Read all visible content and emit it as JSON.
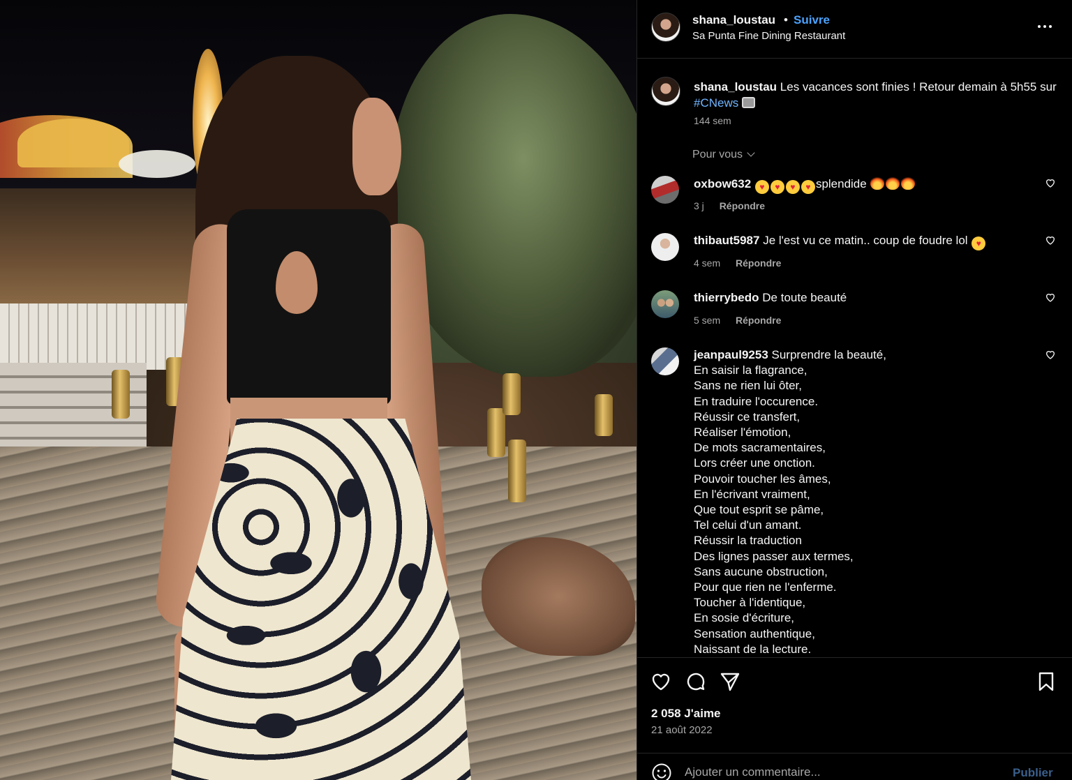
{
  "post": {
    "username": "shana_loustau",
    "separator": "•",
    "follow_label": "Suivre",
    "location": "Sa Punta Fine Dining Restaurant",
    "more_icon": "more-horizontal-icon"
  },
  "caption": {
    "username": "shana_loustau",
    "text_before": "Les vacances sont finies ! Retour demain à 5h55 sur",
    "hashtag": "#CNews",
    "emoji": "television-emoji",
    "time": "144 sem"
  },
  "for_you_label": "Pour vous",
  "comments": [
    {
      "username": "oxbow632",
      "text": "splendide",
      "time": "3 j",
      "reply_label": "Répondre"
    },
    {
      "username": "thibaut5987",
      "text": "Je l'est vu ce matin.. coup de foudre lol",
      "time": "4 sem",
      "reply_label": "Répondre"
    },
    {
      "username": "thierrybedo",
      "text": "De toute beauté",
      "time": "5 sem",
      "reply_label": "Répondre"
    },
    {
      "username": "jeanpaul9253",
      "lines": [
        "Surprendre la beauté,",
        "En saisir la flagrance,",
        "Sans ne rien lui ôter,",
        "En traduire l'occurence.",
        "Réussir ce transfert,",
        "Réaliser l'émotion,",
        "De mots sacramentaires,",
        "Lors créer une onction.",
        "Pouvoir toucher les âmes,",
        "En l'écrivant vraiment,",
        "Que tout esprit se pâme,",
        "Tel celui d'un amant.",
        "Réussir la traduction",
        "Des lignes passer aux termes,",
        "Sans aucune obstruction,",
        "Pour que rien ne l'enferme.",
        "Toucher à  l'identique,",
        "En sosie d'écriture,",
        "Sensation authentique,",
        "Naissant de la lecture."
      ]
    }
  ],
  "actions": {
    "like_icon": "heart-icon",
    "comment_icon": "comment-icon",
    "share_icon": "send-icon",
    "save_icon": "bookmark-icon"
  },
  "likes": "2 058 J'aime",
  "date": "21 août 2022",
  "comment_box": {
    "placeholder": "Ajouter un commentaire...",
    "publish_label": "Publier"
  },
  "colors": {
    "background": "#000000",
    "follow": "#4aa3ff",
    "hashtag": "#6fb4ff",
    "muted": "#a8a8a8",
    "publish": "#3a5f8c"
  }
}
